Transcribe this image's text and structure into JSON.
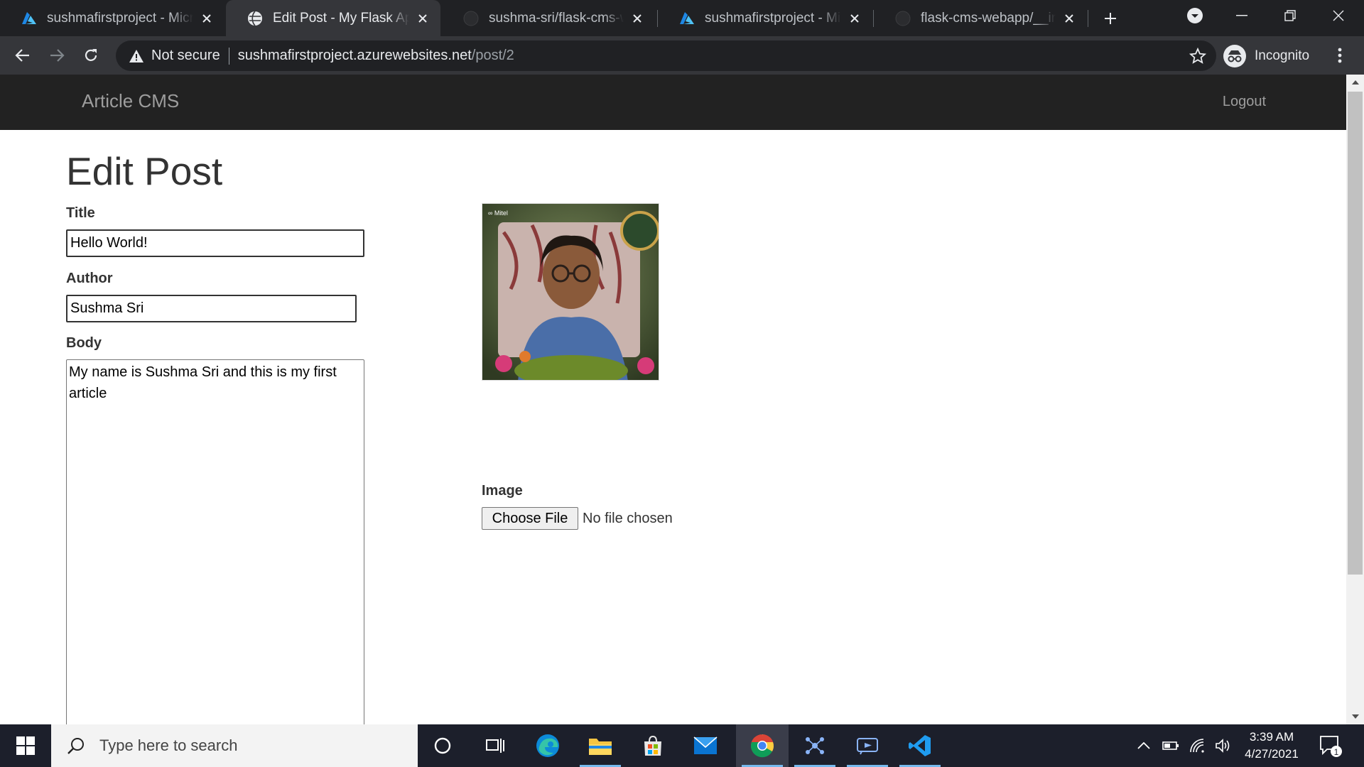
{
  "browser": {
    "tabs": [
      {
        "title": "sushmafirstproject - Microsoft Azure",
        "favicon": "azure-icon",
        "active": false
      },
      {
        "title": "Edit Post - My Flask Application",
        "favicon": "globe-icon",
        "active": true
      },
      {
        "title": "sushma-sri/flask-cms-webapp",
        "favicon": "github-icon",
        "active": false
      },
      {
        "title": "sushmafirstproject - Microsoft Azure",
        "favicon": "azure-icon",
        "active": false
      },
      {
        "title": "flask-cms-webapp/__init__.py",
        "favicon": "github-icon",
        "active": false
      }
    ],
    "security_label": "Not secure",
    "url_host": "sushmafirstproject.azurewebsites.net",
    "url_path": "/post/2",
    "profile_label": "Incognito"
  },
  "app": {
    "brand": "Article CMS",
    "logout_label": "Logout"
  },
  "form": {
    "page_title": "Edit Post",
    "title_label": "Title",
    "title_value": "Hello World!",
    "author_label": "Author",
    "author_value": "Sushma Sri",
    "body_label": "Body",
    "body_value": "My name is Sushma Sri and this is my first article",
    "image_label": "Image",
    "choose_file_label": "Choose File",
    "file_status": "No file chosen"
  },
  "taskbar": {
    "search_placeholder": "Type here to search",
    "time": "3:39 AM",
    "date": "4/27/2021",
    "notification_count": "1"
  },
  "colors": {
    "navbar": "#222222",
    "chrome_dark": "#202124",
    "chrome_toolbar": "#35363a"
  }
}
